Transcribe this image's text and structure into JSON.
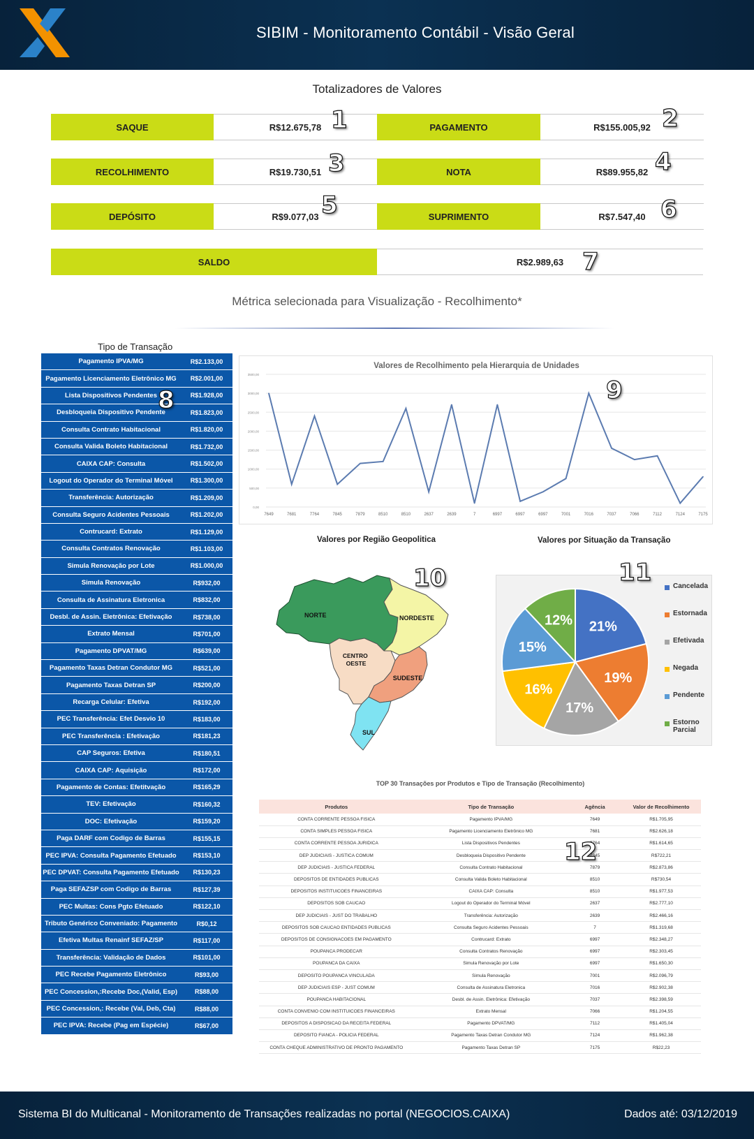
{
  "header": {
    "title": "SIBIM - Monitoramento Contábil - Visão Geral"
  },
  "totals": {
    "title": "Totalizadores de Valores",
    "items": [
      {
        "label": "SAQUE",
        "value": "R$12.675,78",
        "marker": "1"
      },
      {
        "label": "PAGAMENTO",
        "value": "R$155.005,92",
        "marker": "2"
      },
      {
        "label": "RECOLHIMENTO",
        "value": "R$19.730,51",
        "marker": "3"
      },
      {
        "label": "NOTA",
        "value": "R$89.955,82",
        "marker": "4"
      },
      {
        "label": "DEPÓSITO",
        "value": "R$9.077,03",
        "marker": "5"
      },
      {
        "label": "SUPRIMENTO",
        "value": "R$7.547,40",
        "marker": "6"
      }
    ],
    "saldo": {
      "label": "SALDO",
      "value": "R$2.989,63",
      "marker": "7"
    }
  },
  "metric_subtitle": "Métrica selecionada para Visualização - Recolhimento*",
  "transaction_types": {
    "title": "Tipo de Transação",
    "marker": "8",
    "rows": [
      {
        "name": "Pagamento IPVA/MG",
        "value": "R$2.133,00"
      },
      {
        "name": "Pagamento Licenciamento Eletrônico MG",
        "value": "R$2.001,00"
      },
      {
        "name": "Lista Dispositivos Pendentes",
        "value": "R$1.928,00"
      },
      {
        "name": "Desbloqueia Dispositivo Pendente",
        "value": "R$1.823,00"
      },
      {
        "name": "Consulta Contrato Habitacional",
        "value": "R$1.820,00"
      },
      {
        "name": "Consulta Valida Boleto Habitacional",
        "value": "R$1.732,00"
      },
      {
        "name": "CAIXA CAP: Consulta",
        "value": "R$1.502,00"
      },
      {
        "name": "Logout do Operador do Terminal Móvel",
        "value": "R$1.300,00"
      },
      {
        "name": "Transferência: Autorização",
        "value": "R$1.209,00"
      },
      {
        "name": "Consulta Seguro Acidentes Pessoais",
        "value": "R$1.202,00"
      },
      {
        "name": "Contrucard: Extrato",
        "value": "R$1.129,00"
      },
      {
        "name": "Consulta Contratos Renovação",
        "value": "R$1.103,00"
      },
      {
        "name": "Simula Renovação por Lote",
        "value": "R$1.000,00"
      },
      {
        "name": "Simula Renovação",
        "value": "R$932,00"
      },
      {
        "name": "Consulta de Assinatura Eletronica",
        "value": "R$832,00"
      },
      {
        "name": "Desbl. de Assin. Eletrônica: Efetivação",
        "value": "R$738,00"
      },
      {
        "name": "Extrato Mensal",
        "value": "R$701,00"
      },
      {
        "name": "Pagamento DPVAT/MG",
        "value": "R$639,00"
      },
      {
        "name": "Pagamento Taxas Detran Condutor MG",
        "value": "R$521,00"
      },
      {
        "name": "Pagamento Taxas Detran SP",
        "value": "R$200,00"
      },
      {
        "name": "Recarga Celular: Efetiva",
        "value": "R$192,00"
      },
      {
        "name": "PEC  Transferência: Efet Desvio 10",
        "value": "R$183,00"
      },
      {
        "name": "PEC  Transferência : Efetivação",
        "value": "R$181,23"
      },
      {
        "name": "CAP Seguros: Efetiva",
        "value": "R$180,51"
      },
      {
        "name": "CAIXA CAP: Aquisição",
        "value": "R$172,00"
      },
      {
        "name": "Pagamento de Contas: Efetitvação",
        "value": "R$165,29"
      },
      {
        "name": "TEV: Efetivação",
        "value": "R$160,32"
      },
      {
        "name": "DOC: Efetivação",
        "value": "R$159,20"
      },
      {
        "name": "Paga DARF com Codigo de Barras",
        "value": "R$155,15"
      },
      {
        "name": "PEC  IPVA: Consulta Pagamento Efetuado",
        "value": "R$153,10"
      },
      {
        "name": "PEC  DPVAT: Consulta Pagamento Efetuado",
        "value": "R$130,23"
      },
      {
        "name": "Paga SEFAZSP com Codigo de Barras",
        "value": "R$127,39"
      },
      {
        "name": "PEC  Multas: Cons Pgto Efetuado",
        "value": "R$122,10"
      },
      {
        "name": "Tributo Genérico Conveniado: Pagamento",
        "value": "R$0,12"
      },
      {
        "name": "Efetiva Multas Renainf SEFAZ/SP",
        "value": "R$117,00"
      },
      {
        "name": "Transferência: Validação de Dados",
        "value": "R$101,00"
      },
      {
        "name": "PEC  Recebe Pagamento Eletrônico",
        "value": "R$93,00"
      },
      {
        "name": "PEC Concession,:Recebe Doc,(Valid, Esp)",
        "value": "R$88,00"
      },
      {
        "name": "PEC Concession,: Recebe (Val, Deb, Cta)",
        "value": "R$88,00"
      },
      {
        "name": "PEC  IPVA: Recebe (Pag em Espécie)",
        "value": "R$67,00"
      }
    ]
  },
  "line_chart": {
    "title": "Valores de Recolhimento pela Hierarquia de Unidades",
    "marker": "9",
    "color": "#5b7bb0"
  },
  "chart_data": [
    {
      "type": "line",
      "title": "Valores de Recolhimento pela Hierarquia de Unidades",
      "x": [
        "7649",
        "7681",
        "7764",
        "7845",
        "7879",
        "8510",
        "8510",
        "2637",
        "2639",
        "7",
        "6997",
        "6997",
        "6997",
        "7001",
        "7016",
        "7037",
        "7066",
        "7112",
        "7124",
        "7175"
      ],
      "values": [
        3000,
        600,
        2400,
        600,
        1150,
        1200,
        2600,
        400,
        2700,
        100,
        2700,
        150,
        400,
        750,
        3000,
        1550,
        1250,
        1350,
        100,
        800
      ],
      "ylim": [
        0,
        3500
      ],
      "yticks": [
        "0,00",
        "500,00",
        "1000,00",
        "1500,00",
        "2000,00",
        "2500,00",
        "3000,00",
        "3500,00"
      ],
      "grid": true
    },
    {
      "type": "pie",
      "title": "Valores por Situação da Transação",
      "categories": [
        "Cancelada",
        "Estornada",
        "Efetivada",
        "Negada",
        "Pendente",
        "Estorno Parcial"
      ],
      "values": [
        21,
        19,
        17,
        16,
        15,
        12
      ],
      "labels": [
        "21%",
        "19%",
        "17%",
        "16%",
        "15%",
        "12%"
      ],
      "colors": [
        "#4472c4",
        "#ed7d31",
        "#a5a5a5",
        "#ffc000",
        "#5b9bd5",
        "#70ad47"
      ],
      "legend": "right"
    }
  ],
  "map": {
    "title": "Valores por Região Geopolitica",
    "marker": "10",
    "regions": [
      {
        "name": "NORTE",
        "color": "#3a9a5c"
      },
      {
        "name": "NORDESTE",
        "color": "#f4f5a6"
      },
      {
        "name": "CENTRO OESTE",
        "color": "#f7dcc5"
      },
      {
        "name": "SUDESTE",
        "color": "#f0a07e"
      },
      {
        "name": "SUL",
        "color": "#7fe3f2"
      }
    ]
  },
  "pie": {
    "title": "Valores por Situação da Transação",
    "marker": "11",
    "legend": [
      {
        "label": "Cancelada",
        "color": "#4472c4"
      },
      {
        "label": "Estornada",
        "color": "#ed7d31"
      },
      {
        "label": "Efetivada",
        "color": "#a5a5a5"
      },
      {
        "label": "Negada",
        "color": "#ffc000"
      },
      {
        "label": "Pendente",
        "color": "#5b9bd5"
      },
      {
        "label": "Estorno Parcial",
        "color": "#70ad47"
      }
    ]
  },
  "top_table": {
    "title": "TOP 30 Transações por Produtos e Tipo de Transação (Recolhimento)",
    "marker": "12",
    "headers": [
      "Produtos",
      "Tipo de Transação",
      "Agência",
      "Valor de Recolhimento"
    ],
    "rows": [
      [
        "CONTA CORRENTE PESSOA FISICA",
        "Pagamento IPVA/MG",
        "7649",
        "R$1.705,95"
      ],
      [
        "CONTA SIMPLES PESSOA FISICA",
        "Pagamento Licenciamento Eletrônico MG",
        "7681",
        "R$2.626,18"
      ],
      [
        "CONTA CORRENTE PESSOA JURIDICA",
        "Lista Dispositivos Pendentes",
        "7764",
        "R$1.614,65"
      ],
      [
        "DEP JUDICIAIS - JUSTICA COMUM",
        "Desbloqueia Dispositivo Pendente",
        "7845",
        "R$722,21"
      ],
      [
        "DEP JUDICIAIS - JUSTICA FEDERAL",
        "Consulta Contrato Habitacional",
        "7879",
        "R$2.873,86"
      ],
      [
        "DEPOSITOS DE ENTIDADES PUBLICAS",
        "Consulta Valida Boleto Habitacional",
        "8510",
        "R$730,54"
      ],
      [
        "DEPOSITOS INSTITUICOES FINANCEIRAS",
        "CAIXA CAP: Consulta",
        "8510",
        "R$1.977,53"
      ],
      [
        "DEPOSITOS SOB CAUCAO",
        "Logout do Operador do Terminal Móvel",
        "2637",
        "R$2.777,10"
      ],
      [
        "DEP JUDICIAIS - JUST DO TRABALHO",
        "Transferência: Autorização",
        "2639",
        "R$2.466,16"
      ],
      [
        "DEPOSITOS SOB CAUCAO ENTIDADES PUBLICAS",
        "Consulta Seguro Acidentes Pessoais",
        "7",
        "R$1.319,68"
      ],
      [
        "DEPOSITOS DE CONSIGNACOES EM PAGAMENTO",
        "Contrucard: Extrato",
        "6997",
        "R$2.348,27"
      ],
      [
        "POUPANCA PRODECAR",
        "Consulta Contratos Renovação",
        "6997",
        "R$2.303,45"
      ],
      [
        "POUPANCA DA CAIXA",
        "Simula Renovação por Lote",
        "6997",
        "R$1.650,30"
      ],
      [
        "DEPOSITO POUPANCA VINCULADA",
        "Simula Renovação",
        "7001",
        "R$2.096,79"
      ],
      [
        "DEP JUDICIAIS ESP - JUST COMUM",
        "Consulta de Assinatura Eletronica",
        "7016",
        "R$2.902,38"
      ],
      [
        "POUPANCA HABITACIONAL",
        "Desbl. de Assin. Eletrônica: Efetivação",
        "7037",
        "R$2.398,59"
      ],
      [
        "CONTA CONVENIO COM INSTITUICOES FINANCEIRAS",
        "Extrato Mensal",
        "7066",
        "R$1.204,55"
      ],
      [
        "DEPOSITOS A DISPOSICAO DA RECEITA FEDERAL",
        "Pagamento DPVAT/MG",
        "7112",
        "R$1.405,04"
      ],
      [
        "DEPOSITO FIANCA - POLICIA FEDERAL",
        "Pagamento Taxas Detran Condutor MG",
        "7124",
        "R$1.962,38"
      ],
      [
        "CONTA CHEQUE ADMINISTRATIVO DE PRONTO PAGAMENTO",
        "Pagamento Taxas Detran SP",
        "7175",
        "R$22,23"
      ]
    ]
  },
  "footer": {
    "left": "Sistema BI do Multicanal - Monitoramento de Transações realizadas no portal (NEGOCIOS.CAIXA)",
    "right": "Dados até: 03/12/2019"
  }
}
